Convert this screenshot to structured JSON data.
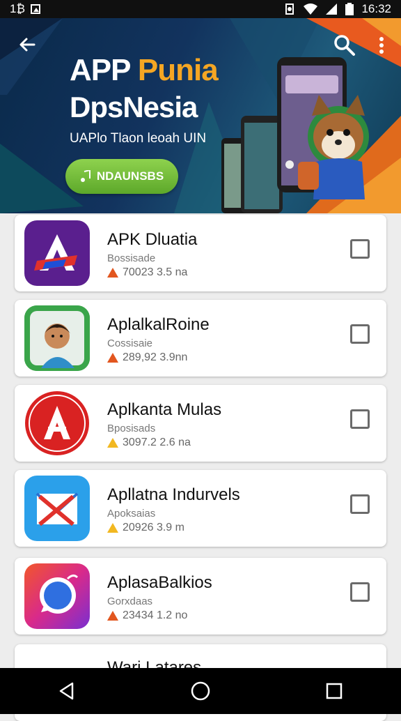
{
  "status_bar": {
    "left_text": "1₿",
    "time": "16:32"
  },
  "banner": {
    "title_part1": "APP ",
    "title_part2": "Punia",
    "title_line2": "DpsNesia",
    "subtitle": "UAPlo Tlaon leoah UIN",
    "cta_label": "NDAUNSBS"
  },
  "apps": [
    {
      "name": "APK Dluatia",
      "category": "Bossisade",
      "meta": "70023 3.5 na",
      "warning": "orange"
    },
    {
      "name": "AplalkalRoine",
      "category": "Cossisaie",
      "meta": "289,92 3.9nn",
      "warning": "orange"
    },
    {
      "name": "Aplkanta Mulas",
      "category": "Bposisads",
      "meta": "3097.2 2.6 na",
      "warning": "yellow"
    },
    {
      "name": "Apllatna Indurvels",
      "category": "Apoksaias",
      "meta": "20926 3.9 m",
      "warning": "yellow"
    },
    {
      "name": "AplasaBalkios",
      "category": "Gorxdaas",
      "meta": "23434 1.2 no",
      "warning": "orange"
    },
    {
      "name": "Wari Latares"
    }
  ],
  "colors": {
    "accent_orange": "#f5a623",
    "cta_green": "#6cba33",
    "banner_bg": "#12335e"
  },
  "icons": {
    "back": "arrow-left-icon",
    "search": "search-icon",
    "menu": "more-vert-icon"
  }
}
